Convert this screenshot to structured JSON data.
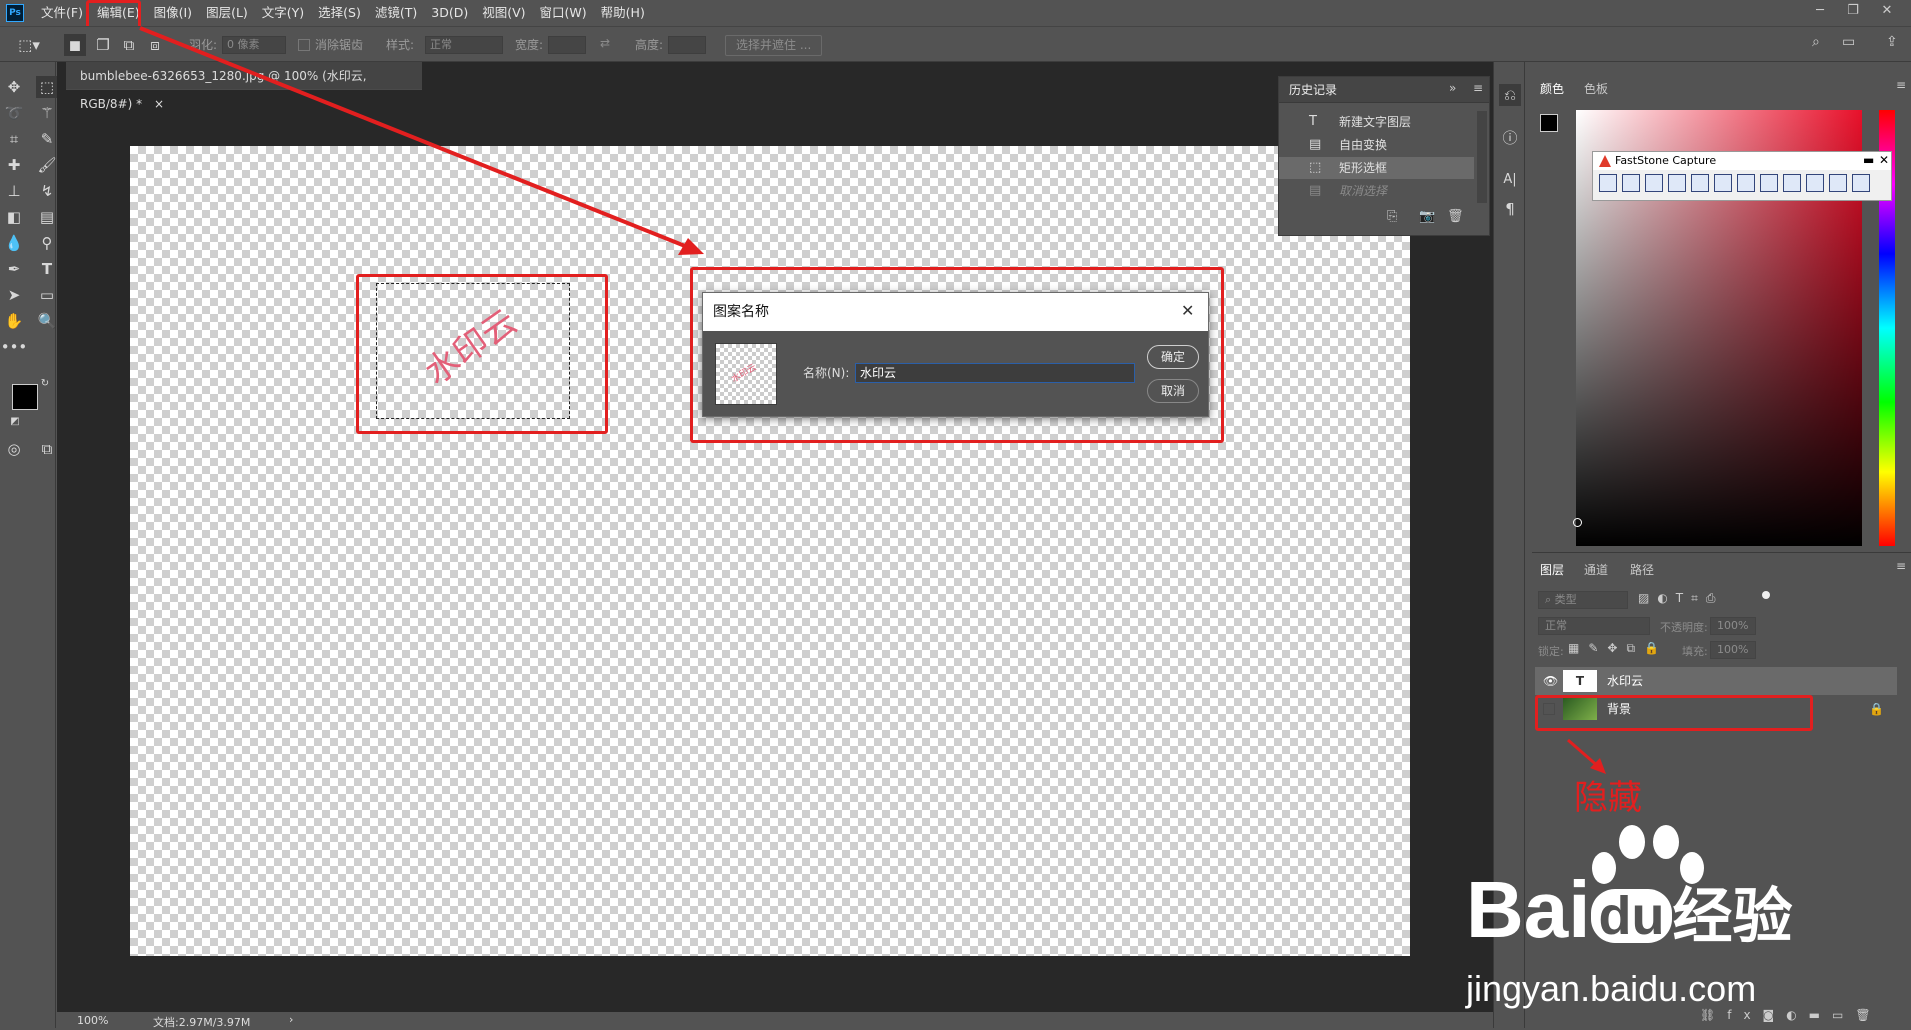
{
  "menubar": {
    "logo": "Ps",
    "items": [
      "文件(F)",
      "编辑(E)",
      "图像(I)",
      "图层(L)",
      "文字(Y)",
      "选择(S)",
      "滤镜(T)",
      "3D(D)",
      "视图(V)",
      "窗口(W)",
      "帮助(H)"
    ]
  },
  "options": {
    "feather_label": "羽化:",
    "feather_value": "0 像素",
    "antialias_label": "消除锯齿",
    "style_label": "样式:",
    "style_value": "正常",
    "width_label": "宽度:",
    "height_label": "高度:",
    "select_mask_button": "选择并遮住 ..."
  },
  "document": {
    "tab_title": "bumblebee-6326653_1280.jpg @ 100% (水印云, RGB/8#) *",
    "close_glyph": "×",
    "watermark_text": "水印云"
  },
  "status": {
    "zoom": "100%",
    "doc_info": "文档:2.97M/3.97M"
  },
  "history": {
    "title": "历史记录",
    "items": [
      {
        "icon": "T",
        "label": "新建文字图层"
      },
      {
        "icon": "▤",
        "label": "自由变换"
      },
      {
        "icon": "⬚",
        "label": "矩形选框"
      },
      {
        "icon": "▤",
        "label": "取消选择"
      }
    ]
  },
  "dialog": {
    "title": "图案名称",
    "name_label": "名称(N):",
    "name_value": "水印云",
    "thumb_text": "水印云",
    "ok_button": "确定",
    "cancel_button": "取消"
  },
  "color_panel": {
    "tabs": [
      "颜色",
      "色板"
    ]
  },
  "faststone": {
    "title": "FastStone Capture"
  },
  "layers_panel": {
    "tabs": [
      "图层",
      "通道",
      "路径"
    ],
    "filter_label": "类型",
    "blend_mode": "正常",
    "opacity_label": "不透明度:",
    "opacity_value": "100%",
    "lock_label": "锁定:",
    "fill_label": "填充:",
    "fill_value": "100%",
    "layers": [
      {
        "name": "水印云",
        "type": "text",
        "visible": true
      },
      {
        "name": "背景",
        "type": "image",
        "visible": false
      }
    ]
  },
  "annotation": {
    "hide_label": "隐藏",
    "color": "#e21f1f"
  },
  "watermark_logo": {
    "brand": "Bai",
    "brand_tail": "经验",
    "du": "du",
    "url": "jingyan.baidu.com"
  }
}
